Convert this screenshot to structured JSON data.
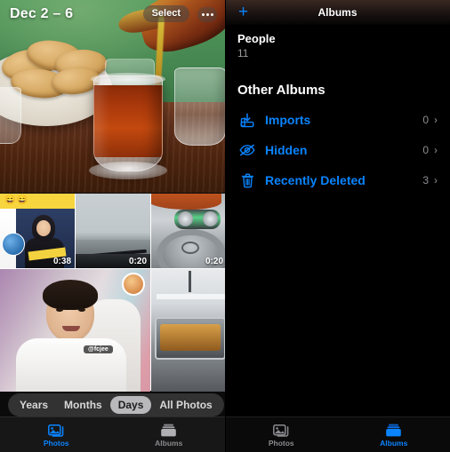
{
  "left_panel": {
    "hero": {
      "date_title": "Dec 2 – 6",
      "select_label": "Select",
      "more_icon": "ellipsis-icon"
    },
    "grid": [
      {
        "id": "thumb-1",
        "duration": "0:38",
        "kind": "video",
        "overlay_text": ""
      },
      {
        "id": "thumb-2",
        "duration": "0:20",
        "kind": "video",
        "overlay_text": ""
      },
      {
        "id": "thumb-3",
        "duration": "0:20",
        "kind": "video",
        "overlay_text": ""
      },
      {
        "id": "thumb-4",
        "duration": "",
        "kind": "photo",
        "overlay_text": "@fcjee"
      },
      {
        "id": "thumb-5",
        "duration": "",
        "kind": "photo",
        "overlay_text": ""
      }
    ],
    "segmented": {
      "options": [
        "Years",
        "Months",
        "Days",
        "All Photos"
      ],
      "selected": "Days"
    },
    "tabbar": {
      "tabs": [
        {
          "label": "Photos",
          "icon": "photos-icon",
          "active": true
        },
        {
          "label": "Albums",
          "icon": "albums-icon",
          "active": false
        }
      ]
    }
  },
  "right_panel": {
    "nav": {
      "add_icon": "plus-icon",
      "title": "Albums"
    },
    "people": {
      "name": "People",
      "count": "11"
    },
    "other_albums": {
      "title": "Other Albums",
      "rows": [
        {
          "icon": "import-icon",
          "label": "Imports",
          "count": "0",
          "chevron": "›"
        },
        {
          "icon": "eye-slash-icon",
          "label": "Hidden",
          "count": "0",
          "chevron": "›"
        },
        {
          "icon": "trash-icon",
          "label": "Recently Deleted",
          "count": "3",
          "chevron": "›"
        }
      ]
    },
    "tabbar": {
      "tabs": [
        {
          "label": "Photos",
          "icon": "photos-icon",
          "active": false
        },
        {
          "label": "Albums",
          "icon": "albums-icon",
          "active": true
        }
      ]
    }
  },
  "colors": {
    "accent_blue": "#0a84ff",
    "background": "#000000",
    "secondary_text": "#8e8e93"
  }
}
